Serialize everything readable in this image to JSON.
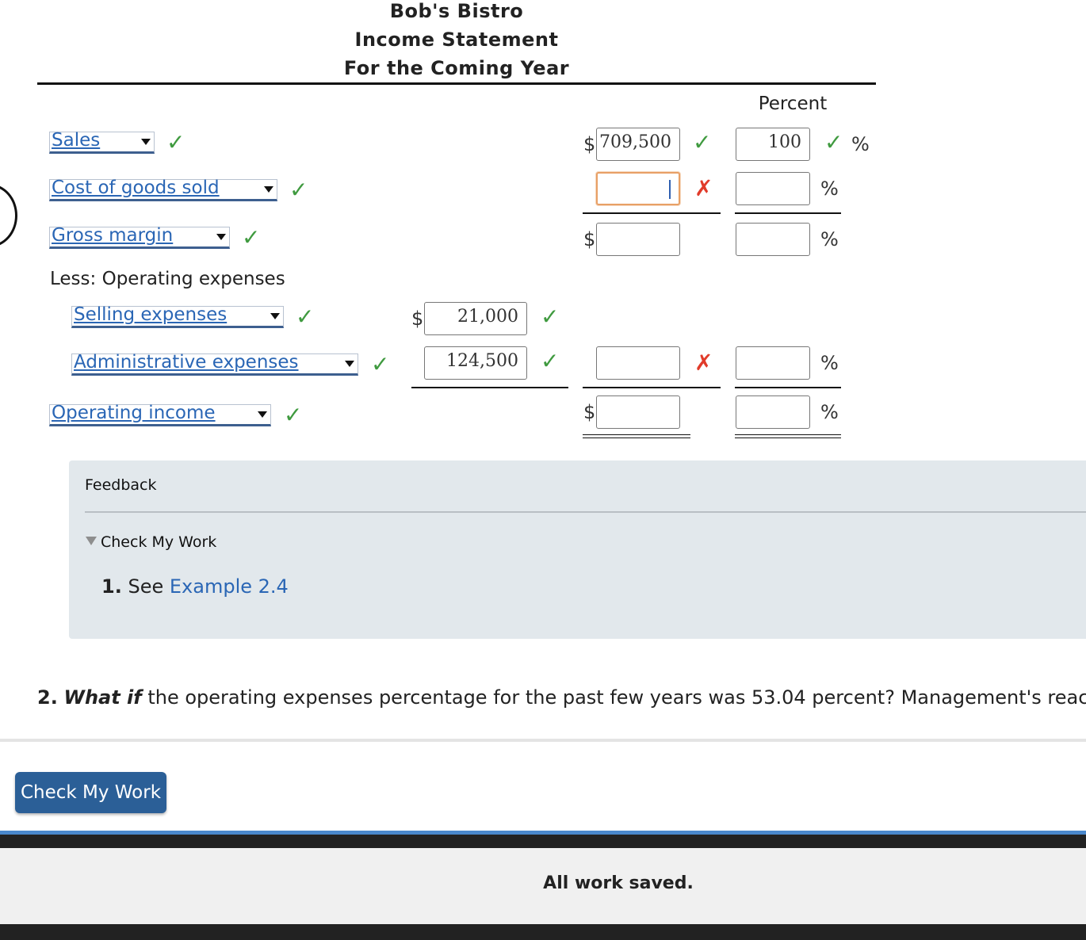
{
  "header": {
    "line1": "Bob's Bistro",
    "line2": "Income Statement",
    "line3": "For the Coming Year"
  },
  "columns": {
    "percent_label": "Percent"
  },
  "rows": {
    "sales": {
      "label": "Sales",
      "amount": "709,500",
      "percent": "100",
      "currency": "$",
      "pct_sign": "%"
    },
    "cogs": {
      "label": "Cost of goods sold",
      "amount": "",
      "percent": "",
      "pct_sign": "%"
    },
    "gross_margin": {
      "label": "Gross margin",
      "amount": "",
      "percent": "",
      "currency": "$",
      "pct_sign": "%"
    },
    "less_opex": {
      "label": "Less: Operating expenses"
    },
    "selling": {
      "label": "Selling expenses",
      "amount": "21,000",
      "currency": "$"
    },
    "admin": {
      "label": "Administrative expenses",
      "amount": "124,500",
      "total": "",
      "percent": "",
      "pct_sign": "%"
    },
    "operating_income": {
      "label": "Operating income",
      "amount": "",
      "percent": "",
      "currency": "$",
      "pct_sign": "%"
    }
  },
  "marks": {
    "check": "✓",
    "cross": "✗"
  },
  "feedback": {
    "title": "Feedback",
    "toggle_label": "Check My Work",
    "item_number": "1.",
    "item_text": "See",
    "item_link": "Example 2.4"
  },
  "question2": {
    "number": "2.",
    "emphasis": "What if",
    "text": "the operating expenses percentage for the past few years was 53.04 percent? Management's reac"
  },
  "button": {
    "label": "Check My Work"
  },
  "status": {
    "text": "All work saved."
  }
}
